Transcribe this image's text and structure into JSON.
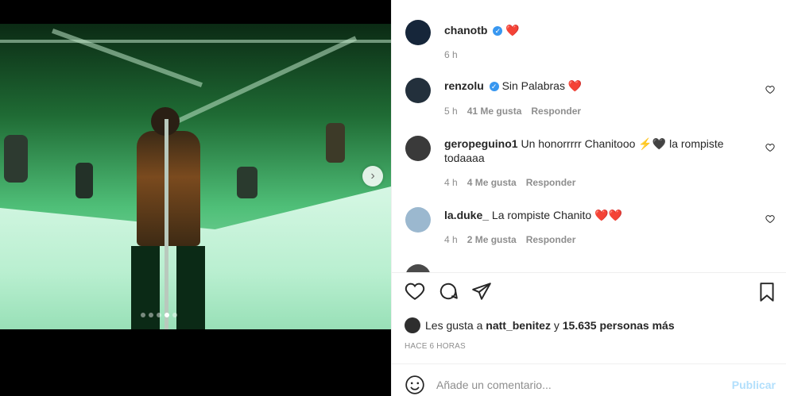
{
  "post": {
    "author": "chanotb",
    "author_emoji": "❤️",
    "author_time": "6 h",
    "next_icon": "chevron-right-icon"
  },
  "comments": [
    {
      "user": "renzolu",
      "verified": true,
      "text": "Sin Palabras",
      "emoji": "❤️",
      "time": "5 h",
      "likes": "41 Me gusta",
      "reply": "Responder"
    },
    {
      "user": "geropeguino1",
      "verified": false,
      "text": "Un honorrrrr Chanitooo",
      "emoji": "⚡🖤",
      "text2": "la rompiste todaaaa",
      "time": "4 h",
      "likes": "4 Me gusta",
      "reply": "Responder"
    },
    {
      "user": "la.duke_",
      "verified": false,
      "text": "La rompiste Chanito",
      "emoji": "❤️❤️",
      "time": "4 h",
      "likes": "2 Me gusta",
      "reply": "Responder"
    }
  ],
  "likes_line": {
    "prefix": "Les gusta a",
    "user": "natt_benitez",
    "mid": "y",
    "count": "15.635 personas más"
  },
  "time_ago": "HACE 6 HORAS",
  "add_comment": {
    "placeholder": "Añade un comentario...",
    "publish": "Publicar"
  },
  "colors": {
    "accent": "#3897f0",
    "heart": "#e0245e",
    "muted": "#8e8e8e",
    "publish": "#b2dffc"
  }
}
